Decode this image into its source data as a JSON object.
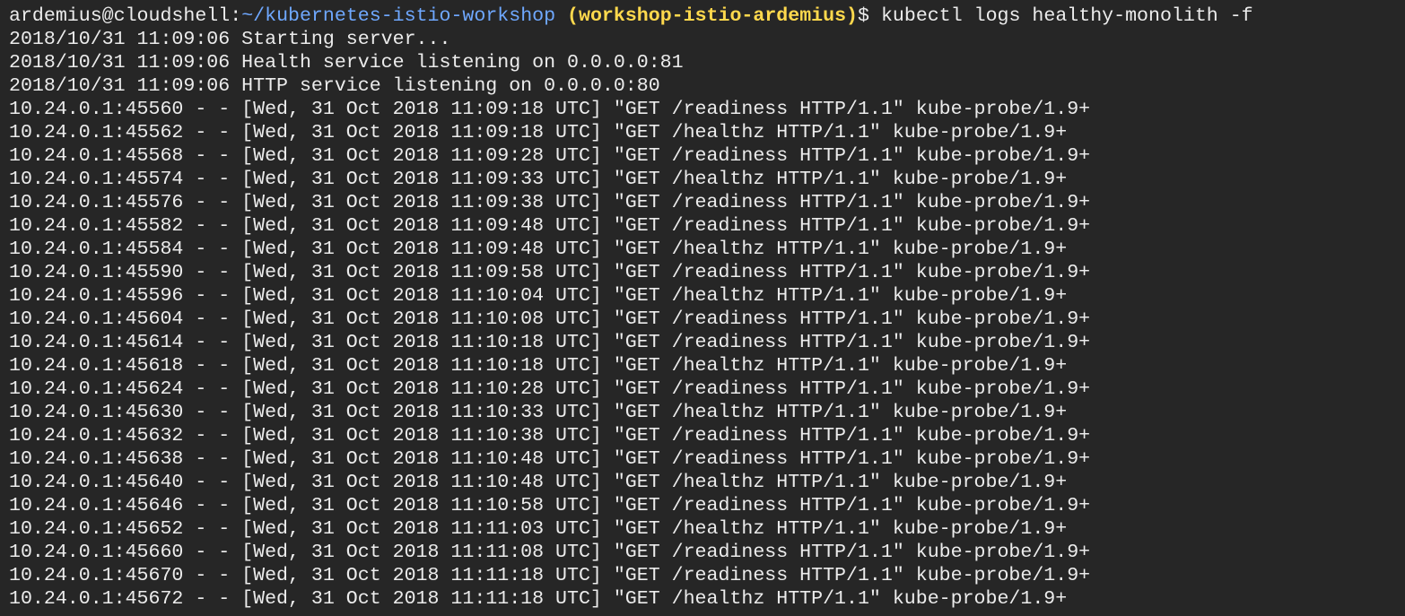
{
  "prompt": {
    "user_host": "ardemius@cloudshell",
    "sep": ":",
    "path": "~/kubernetes-istio-workshop",
    "project": "(workshop-istio-ardemius)",
    "symbol": "$",
    "command": "kubectl logs healthy-monolith -f"
  },
  "output_lines": [
    "2018/10/31 11:09:06 Starting server...",
    "2018/10/31 11:09:06 Health service listening on 0.0.0.0:81",
    "2018/10/31 11:09:06 HTTP service listening on 0.0.0.0:80",
    "10.24.0.1:45560 - - [Wed, 31 Oct 2018 11:09:18 UTC] \"GET /readiness HTTP/1.1\" kube-probe/1.9+",
    "10.24.0.1:45562 - - [Wed, 31 Oct 2018 11:09:18 UTC] \"GET /healthz HTTP/1.1\" kube-probe/1.9+",
    "10.24.0.1:45568 - - [Wed, 31 Oct 2018 11:09:28 UTC] \"GET /readiness HTTP/1.1\" kube-probe/1.9+",
    "10.24.0.1:45574 - - [Wed, 31 Oct 2018 11:09:33 UTC] \"GET /healthz HTTP/1.1\" kube-probe/1.9+",
    "10.24.0.1:45576 - - [Wed, 31 Oct 2018 11:09:38 UTC] \"GET /readiness HTTP/1.1\" kube-probe/1.9+",
    "10.24.0.1:45582 - - [Wed, 31 Oct 2018 11:09:48 UTC] \"GET /readiness HTTP/1.1\" kube-probe/1.9+",
    "10.24.0.1:45584 - - [Wed, 31 Oct 2018 11:09:48 UTC] \"GET /healthz HTTP/1.1\" kube-probe/1.9+",
    "10.24.0.1:45590 - - [Wed, 31 Oct 2018 11:09:58 UTC] \"GET /readiness HTTP/1.1\" kube-probe/1.9+",
    "10.24.0.1:45596 - - [Wed, 31 Oct 2018 11:10:04 UTC] \"GET /healthz HTTP/1.1\" kube-probe/1.9+",
    "10.24.0.1:45604 - - [Wed, 31 Oct 2018 11:10:08 UTC] \"GET /readiness HTTP/1.1\" kube-probe/1.9+",
    "10.24.0.1:45614 - - [Wed, 31 Oct 2018 11:10:18 UTC] \"GET /readiness HTTP/1.1\" kube-probe/1.9+",
    "10.24.0.1:45618 - - [Wed, 31 Oct 2018 11:10:18 UTC] \"GET /healthz HTTP/1.1\" kube-probe/1.9+",
    "10.24.0.1:45624 - - [Wed, 31 Oct 2018 11:10:28 UTC] \"GET /readiness HTTP/1.1\" kube-probe/1.9+",
    "10.24.0.1:45630 - - [Wed, 31 Oct 2018 11:10:33 UTC] \"GET /healthz HTTP/1.1\" kube-probe/1.9+",
    "10.24.0.1:45632 - - [Wed, 31 Oct 2018 11:10:38 UTC] \"GET /readiness HTTP/1.1\" kube-probe/1.9+",
    "10.24.0.1:45638 - - [Wed, 31 Oct 2018 11:10:48 UTC] \"GET /readiness HTTP/1.1\" kube-probe/1.9+",
    "10.24.0.1:45640 - - [Wed, 31 Oct 2018 11:10:48 UTC] \"GET /healthz HTTP/1.1\" kube-probe/1.9+",
    "10.24.0.1:45646 - - [Wed, 31 Oct 2018 11:10:58 UTC] \"GET /readiness HTTP/1.1\" kube-probe/1.9+",
    "10.24.0.1:45652 - - [Wed, 31 Oct 2018 11:11:03 UTC] \"GET /healthz HTTP/1.1\" kube-probe/1.9+",
    "10.24.0.1:45660 - - [Wed, 31 Oct 2018 11:11:08 UTC] \"GET /readiness HTTP/1.1\" kube-probe/1.9+",
    "10.24.0.1:45670 - - [Wed, 31 Oct 2018 11:11:18 UTC] \"GET /readiness HTTP/1.1\" kube-probe/1.9+",
    "10.24.0.1:45672 - - [Wed, 31 Oct 2018 11:11:18 UTC] \"GET /healthz HTTP/1.1\" kube-probe/1.9+"
  ],
  "colors": {
    "background": "#262626",
    "text": "#ececec",
    "path": "#6fa8ff",
    "project": "#ffd94d"
  }
}
